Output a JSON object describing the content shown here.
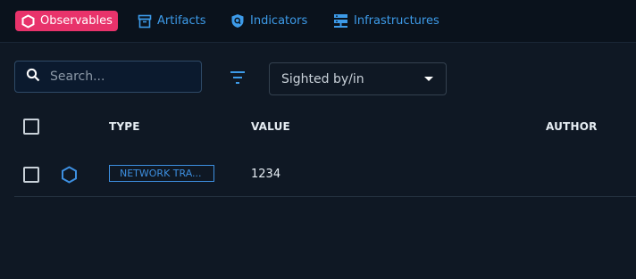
{
  "tabs": [
    {
      "label": "Observables",
      "icon": "hexagon-icon",
      "active": true
    },
    {
      "label": "Artifacts",
      "icon": "archive-icon",
      "active": false
    },
    {
      "label": "Indicators",
      "icon": "shield-search-icon",
      "active": false
    },
    {
      "label": "Infrastructures",
      "icon": "server-icon",
      "active": false
    }
  ],
  "search": {
    "placeholder": "Search...",
    "value": ""
  },
  "filter": {
    "icon": "filter-icon"
  },
  "sighted_select": {
    "value": "Sighted by/in"
  },
  "table": {
    "headers": [
      "TYPE",
      "VALUE",
      "AUTHOR"
    ],
    "rows": [
      {
        "type": "NETWORK TRA...",
        "value": "1234",
        "author": "",
        "icon": "hexagon-icon"
      }
    ]
  },
  "colors": {
    "accent": "#e8336b",
    "link": "#3d9be9",
    "background": "#0f1824"
  }
}
